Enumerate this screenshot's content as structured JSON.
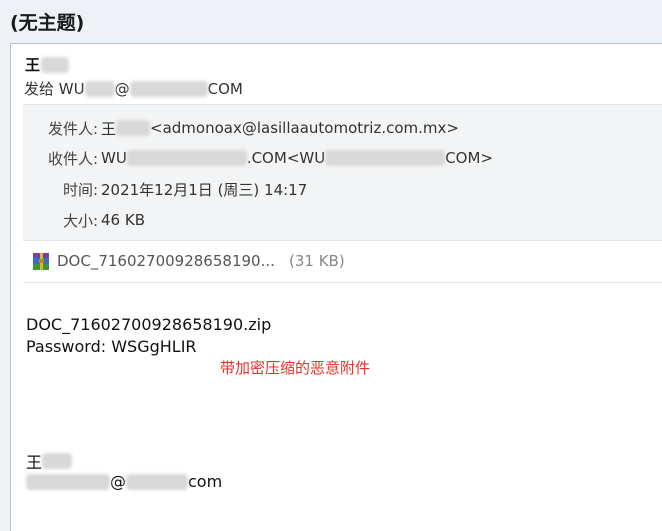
{
  "subject": "(无主题)",
  "sender": {
    "name_visible": "王"
  },
  "sendto": {
    "prefix": "发给 WU",
    "at": "@",
    "suffix": "COM"
  },
  "details": {
    "from_label": "发件人:",
    "from_name_visible": "王",
    "from_email": "<admonoax@lasillaautomotriz.com.mx>",
    "to_label": "收件人:",
    "to_visible_prefix": "WU",
    "to_visible_suffix": ".COM",
    "to_email_prefix": "<WU",
    "to_email_suffix": "COM>",
    "time_label": "时间:",
    "time_value": "2021年12月1日 (周三) 14:17",
    "size_label": "大小:",
    "size_value": "46 KB"
  },
  "attachment": {
    "icon": "zip-archive-icon",
    "name": "DOC_71602700928658190...",
    "size": "(31 KB)"
  },
  "body": {
    "line1": "DOC_71602700928658190.zip",
    "line2": "Password: WSGgHLIR",
    "signature_name_visible": "王",
    "signature_at": "@",
    "signature_domain_suffix": "com"
  },
  "annotation": {
    "text": "带加密压缩的恶意附件",
    "color": "#e8312a"
  }
}
